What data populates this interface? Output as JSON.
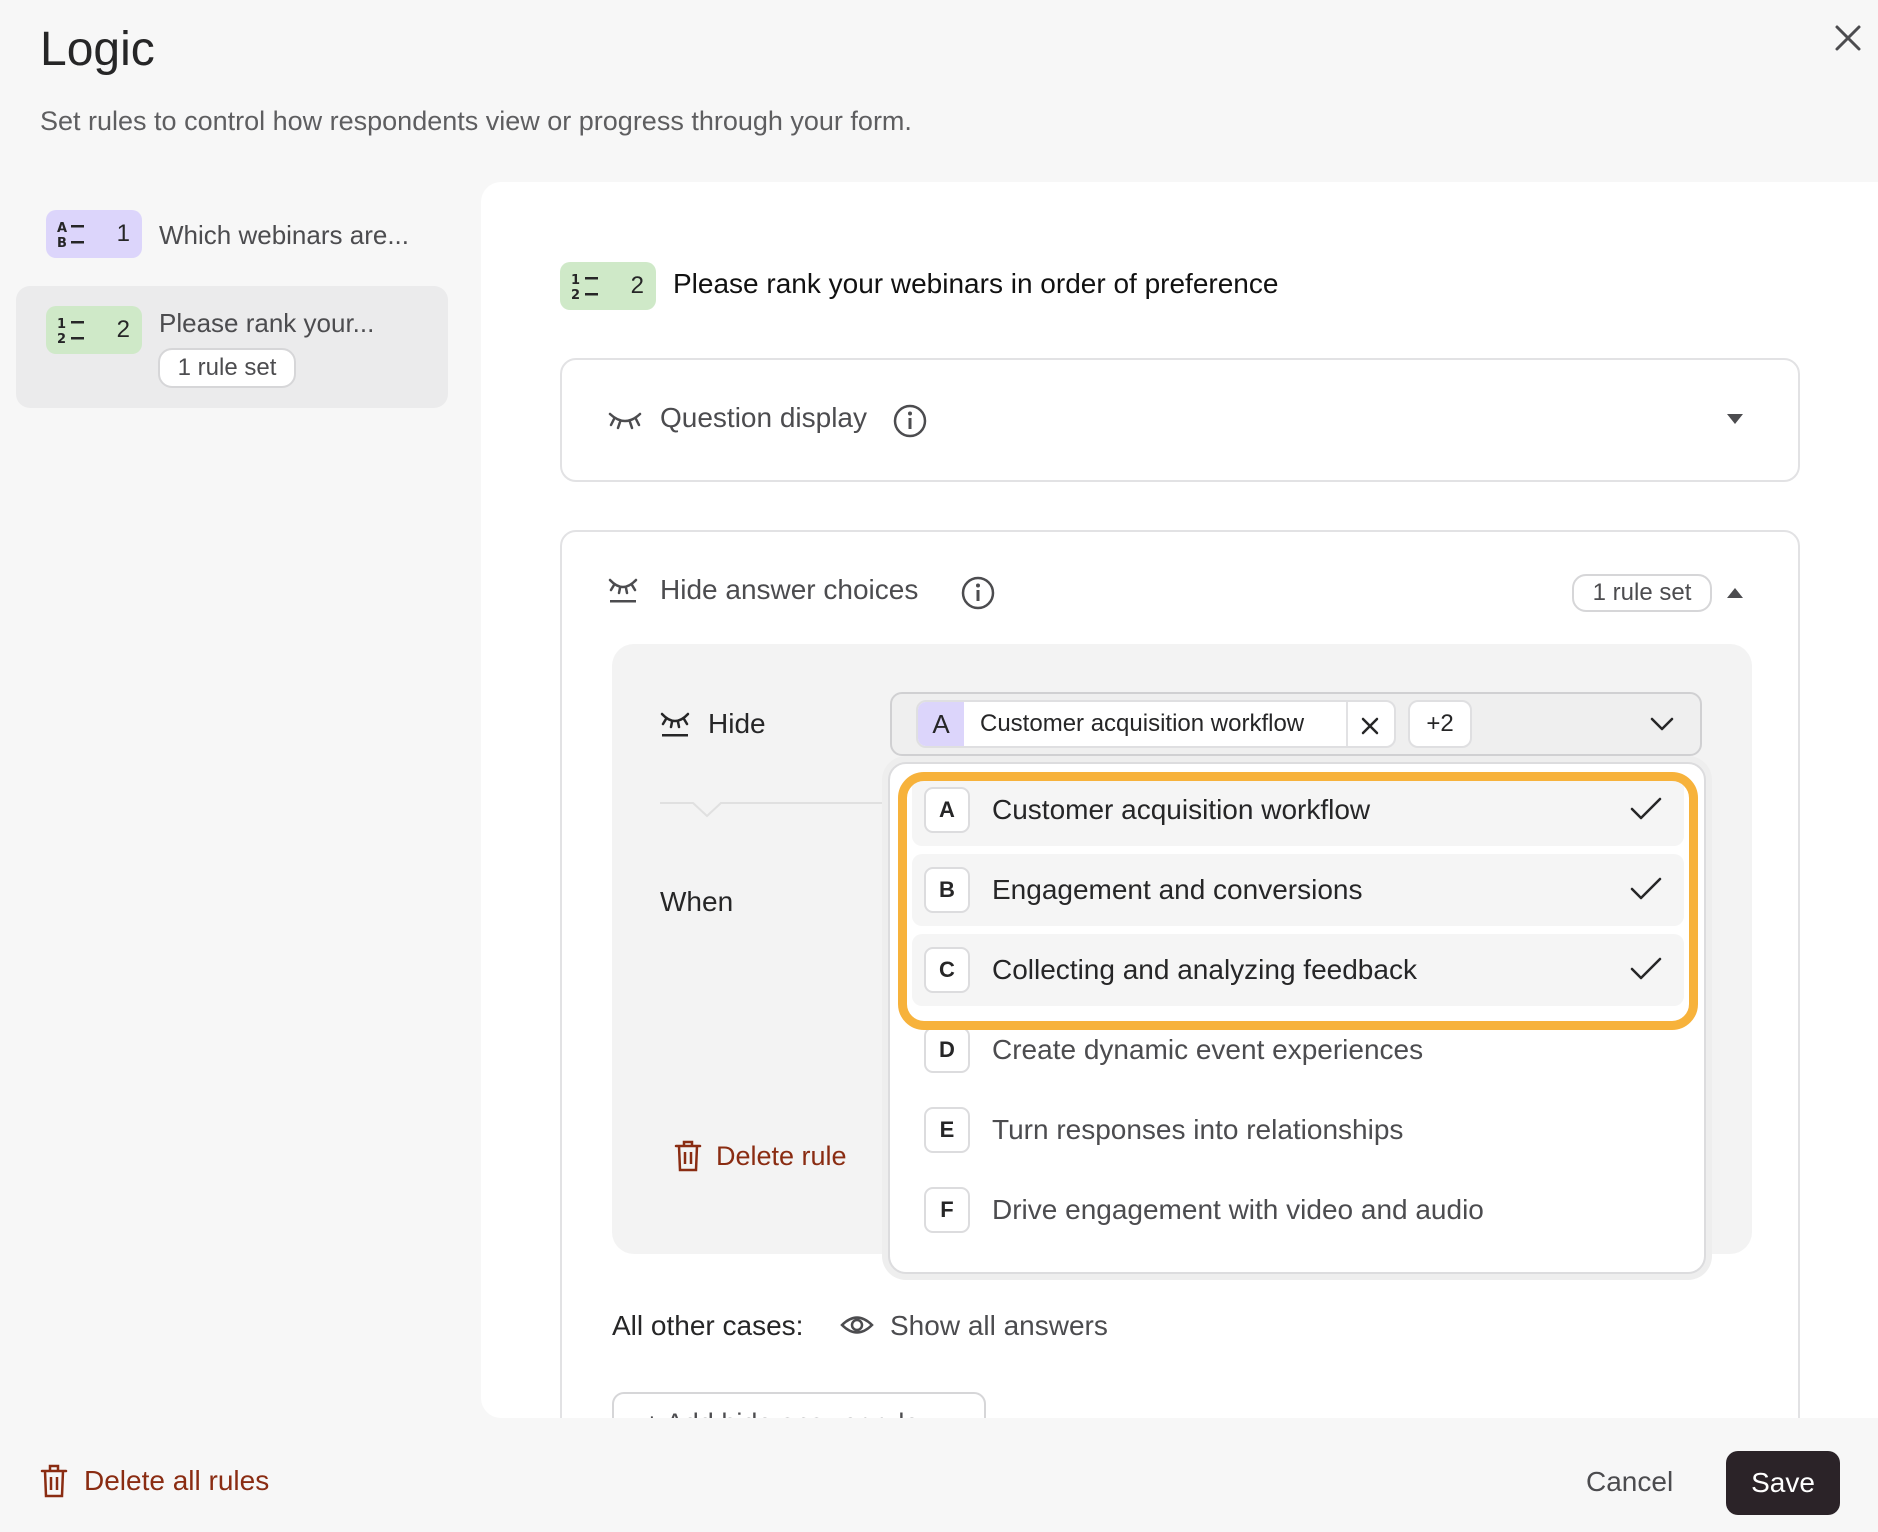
{
  "header": {
    "title": "Logic",
    "subtitle": "Set rules to control how respondents view or progress through your form."
  },
  "sidebar": {
    "items": [
      {
        "number": "1",
        "label": "Which webinars are...",
        "badge_color": "#dcd5fb",
        "icon": "multiple-choice-icon"
      },
      {
        "number": "2",
        "label": "Please rank your...",
        "badge_color": "#cfe9c8",
        "icon": "ranking-icon",
        "rules": "1 rule set",
        "active": true
      }
    ]
  },
  "question": {
    "number": "2",
    "title": "Please rank your webinars in order of preference"
  },
  "question_display": {
    "title": "Question display"
  },
  "hide_answers": {
    "title": "Hide answer choices",
    "rules_badge": "1 rule set",
    "hide_label": "Hide",
    "when_label": "When",
    "delete_rule": "Delete rule",
    "selected_chip": {
      "letter": "A",
      "label": "Customer acquisition workflow"
    },
    "more_count": "+2",
    "other_cases_label": "All other cases:",
    "other_cases_value": "Show all answers",
    "add_rule": "+ Add hide answer rule"
  },
  "dropdown": {
    "options": [
      {
        "letter": "A",
        "label": "Customer acquisition workflow",
        "selected": true
      },
      {
        "letter": "B",
        "label": "Engagement and conversions",
        "selected": true
      },
      {
        "letter": "C",
        "label": "Collecting and analyzing feedback",
        "selected": true
      },
      {
        "letter": "D",
        "label": "Create dynamic event experiences",
        "selected": false
      },
      {
        "letter": "E",
        "label": "Turn responses into relationships",
        "selected": false
      },
      {
        "letter": "F",
        "label": "Drive engagement with video and audio",
        "selected": false
      }
    ]
  },
  "footer": {
    "delete_all": "Delete all rules",
    "cancel": "Cancel",
    "save": "Save"
  },
  "colors": {
    "highlight": "#f7b23b",
    "danger": "#8a2c12",
    "save_bg": "#2b2328"
  }
}
